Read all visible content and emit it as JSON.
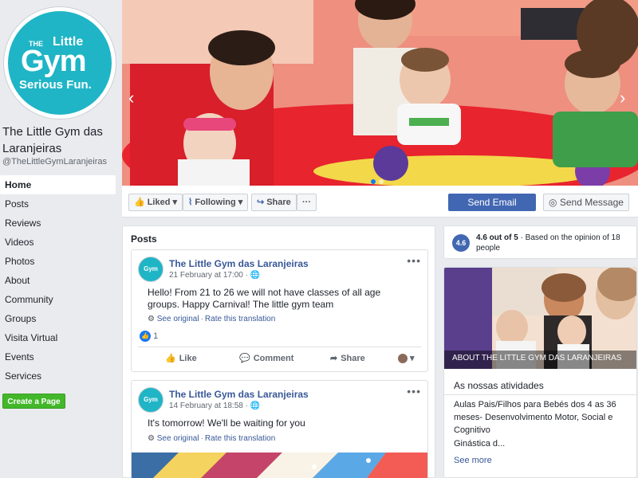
{
  "page": {
    "name": "The Little Gym das Laranjeiras",
    "handle": "@TheLittleGymLaranjeiras",
    "logo": {
      "the": "THE",
      "little": "Little",
      "gym": "Gym",
      "tagline": "Serious Fun."
    }
  },
  "nav": {
    "items": [
      {
        "label": "Home",
        "active": true
      },
      {
        "label": "Posts"
      },
      {
        "label": "Reviews"
      },
      {
        "label": "Videos"
      },
      {
        "label": "Photos"
      },
      {
        "label": "About"
      },
      {
        "label": "Community"
      },
      {
        "label": "Groups"
      },
      {
        "label": "Visita Virtual"
      },
      {
        "label": "Events"
      },
      {
        "label": "Services"
      }
    ],
    "create_page": "Create a Page"
  },
  "actionbar": {
    "liked": "Liked",
    "following": "Following",
    "share": "Share",
    "more": "···",
    "send_email": "Send Email",
    "send_message": "Send Message"
  },
  "posts": {
    "title": "Posts",
    "items": [
      {
        "author": "The Little Gym das Laranjeiras",
        "date": "21 February at 17:00 ·",
        "text": "Hello! From 21 to 26 we will not have classes of all age groups. Happy Carnival! The little gym team",
        "see_original": "See original",
        "rate_translation": "Rate this translation",
        "reactions": "1",
        "like": "Like",
        "comment": "Comment",
        "share": "Share"
      },
      {
        "author": "The Little Gym das Laranjeiras",
        "date": "14 February at 18:58 ·",
        "text": "It's tomorrow! We'll be waiting for you",
        "see_original": "See original",
        "rate_translation": "Rate this translation"
      }
    ]
  },
  "rating": {
    "score": "4.6",
    "label": "4.6 out of 5",
    "basis": " · Based on the opinion of 18 people"
  },
  "about": {
    "caption": "ABOUT THE LITTLE GYM DAS LARANJEIRAS",
    "heading": "As nossas atividades",
    "description": "Aulas Pais/Filhos para Bebés dos 4 as 36 meses- Desenvolvimento Motor, Social e Cognitivo",
    "sub": "Ginástica d...",
    "see_more": "See more"
  },
  "colors": {
    "brand_blue": "#4267b2",
    "link_blue": "#385898",
    "create_green": "#42b72a",
    "logo_teal": "#1fb5c6"
  }
}
